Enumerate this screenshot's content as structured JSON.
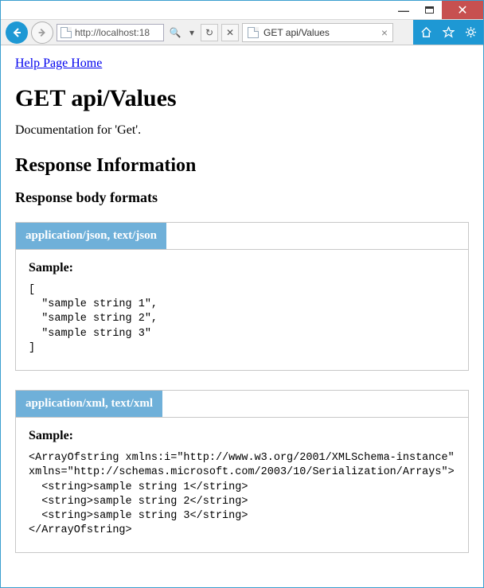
{
  "window": {
    "minimize": "—",
    "close": "✕"
  },
  "toolbar": {
    "url": "http://localhost:18",
    "search_glyph": "🔍",
    "dropdown_glyph": "▾",
    "refresh_glyph": "↻",
    "stop_glyph": "✕",
    "tab_title": "GET api/Values",
    "tab_close": "×"
  },
  "page": {
    "home_link": "Help Page Home",
    "title": "GET api/Values",
    "doc": "Documentation for 'Get'.",
    "section_title": "Response Information",
    "subsection_title": "Response body formats",
    "panels": [
      {
        "header": "application/json, text/json",
        "label": "Sample:",
        "sample": "[\n  \"sample string 1\",\n  \"sample string 2\",\n  \"sample string 3\"\n]"
      },
      {
        "header": "application/xml, text/xml",
        "label": "Sample:",
        "sample": "<ArrayOfstring xmlns:i=\"http://www.w3.org/2001/XMLSchema-instance\"\nxmlns=\"http://schemas.microsoft.com/2003/10/Serialization/Arrays\">\n  <string>sample string 1</string>\n  <string>sample string 2</string>\n  <string>sample string 3</string>\n</ArrayOfstring>"
      }
    ]
  }
}
